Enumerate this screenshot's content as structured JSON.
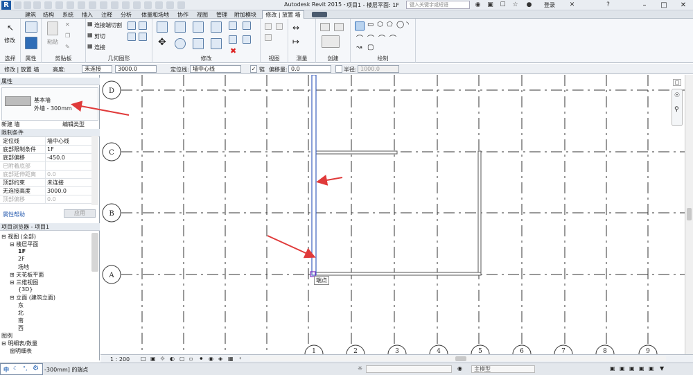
{
  "app": {
    "title": "Autodesk Revit 2015 -",
    "project_title": "项目1 - 楼层平面: 1F",
    "search_placeholder": "键入关键字或短语",
    "login": "登录",
    "logo": "R"
  },
  "menus": [
    "建筑",
    "结构",
    "系统",
    "插入",
    "注释",
    "分析",
    "体量和场地",
    "协作",
    "视图",
    "管理",
    "附加模块"
  ],
  "active_tab": "修改 | 放置 墙",
  "ribbon": {
    "panels": [
      "选择",
      "属性",
      "剪贴板",
      "几何图形",
      "修改",
      "视图",
      "测量",
      "创建",
      "绘制"
    ],
    "modify_label": "修改",
    "paste_label": "粘贴",
    "clip_items": [
      "连接端切割",
      "剪切",
      "连接"
    ]
  },
  "options_bar": {
    "mode": "修改 | 放置 墙",
    "height_label": "高度:",
    "height_mode": "未连接",
    "height_value": "3000.0",
    "location_label": "定位线:",
    "location_value": "墙中心线",
    "chain_label": "链",
    "offset_label": "偏移量:",
    "offset_value": "0.0",
    "radius_label": "半径:",
    "radius_value": "1000.0"
  },
  "properties": {
    "header": "属性",
    "family": "基本墙",
    "type": "外墙 - 300mm",
    "instance_selector": "新建 墙",
    "edit_type": "编辑类型",
    "section": "限制条件",
    "rows": [
      {
        "k": "定位线",
        "v": "墙中心线"
      },
      {
        "k": "底部限制条件",
        "v": "1F"
      },
      {
        "k": "底部偏移",
        "v": "-450.0"
      },
      {
        "k": "已附着底部",
        "v": ""
      },
      {
        "k": "底部延伸距离",
        "v": "0.0"
      },
      {
        "k": "顶部约束",
        "v": "未连接"
      },
      {
        "k": "无连接高度",
        "v": "3000.0"
      },
      {
        "k": "顶部偏移",
        "v": "0.0"
      }
    ],
    "help": "属性帮助",
    "apply": "应用"
  },
  "browser": {
    "header": "项目浏览器 - 项目1",
    "nodes": [
      {
        "t": "视图 (全部)",
        "lvl": 0,
        "exp": "-"
      },
      {
        "t": "楼层平面",
        "lvl": 1,
        "exp": "-"
      },
      {
        "t": "1F",
        "lvl": 2,
        "bold": true
      },
      {
        "t": "2F",
        "lvl": 2
      },
      {
        "t": "场地",
        "lvl": 2
      },
      {
        "t": "天花板平面",
        "lvl": 1,
        "exp": "+"
      },
      {
        "t": "三维视图",
        "lvl": 1,
        "exp": "-"
      },
      {
        "t": "{3D}",
        "lvl": 2
      },
      {
        "t": "立面 (建筑立面)",
        "lvl": 1,
        "exp": "-"
      },
      {
        "t": "东",
        "lvl": 2
      },
      {
        "t": "北",
        "lvl": 2
      },
      {
        "t": "南",
        "lvl": 2
      },
      {
        "t": "西",
        "lvl": 2
      },
      {
        "t": "图例",
        "lvl": 0
      },
      {
        "t": "明细表/数量",
        "lvl": 0,
        "exp": "-"
      },
      {
        "t": "窗明细表",
        "lvl": 1
      }
    ]
  },
  "grid": {
    "h_labels": [
      "D",
      "C",
      "B",
      "A"
    ],
    "v_labels": [
      "1",
      "2",
      "3",
      "4",
      "5",
      "6",
      "7",
      "8",
      "9"
    ]
  },
  "snap_tooltip": "端点",
  "view_control": {
    "scale": "1 : 200"
  },
  "status": {
    "text": "-300mm] 的端点",
    "model": "主模型",
    "ime": "中"
  },
  "colors": {
    "arrow": "#e03a3a",
    "ribbon_bg": "#f5f7fa",
    "title_bg": "#e9edf2",
    "wall": "#555555",
    "highlight_wall": "#3b5fbf"
  }
}
